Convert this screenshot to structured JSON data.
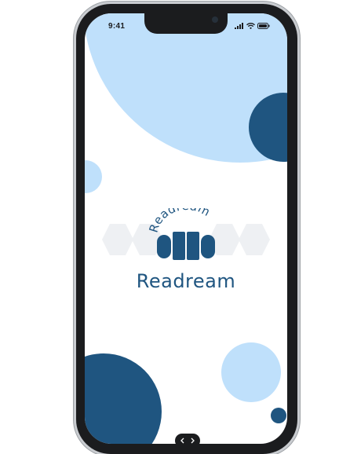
{
  "status_bar": {
    "time": "9:41"
  },
  "logo": {
    "arc_text": "Readream"
  },
  "app": {
    "name": "Readream"
  },
  "colors": {
    "primary": "#1f5580",
    "light": "#bfe0fb",
    "bezel": "#1b1c1e"
  },
  "icons": [
    "signal-icon",
    "wifi-icon",
    "battery-icon",
    "book-logo-icon",
    "home-indicator-icon"
  ]
}
